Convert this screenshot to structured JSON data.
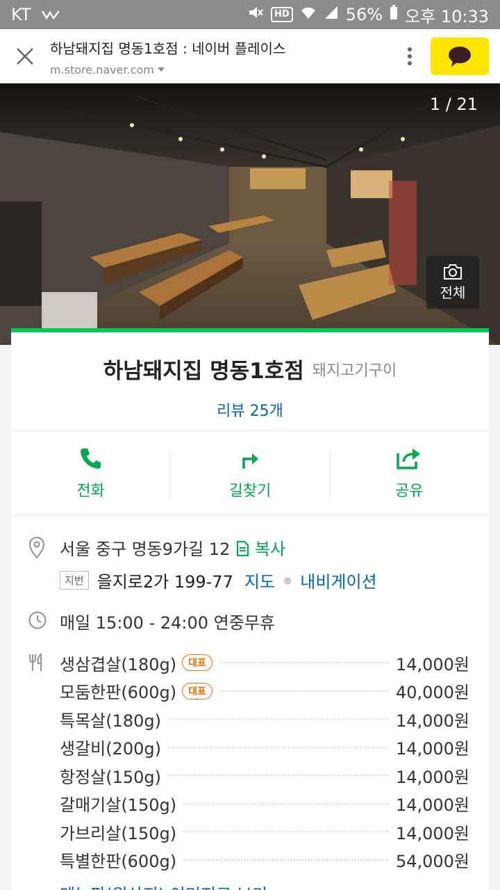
{
  "status_bar": {
    "carrier": "KT",
    "hd_label": "HD",
    "battery": "56%",
    "time": "오후 10:33"
  },
  "browser": {
    "title": "하남돼지집 명동1호점 : 네이버 플레이스",
    "url": "m.store.naver.com"
  },
  "hero": {
    "counter": "1 / 21",
    "view_all_label": "전체"
  },
  "place": {
    "name": "하남돼지집 명동1호점",
    "category": "돼지고기구이",
    "review_link": "리뷰 25개"
  },
  "actions": [
    {
      "label": "전화",
      "icon": "phone-icon"
    },
    {
      "label": "길찾기",
      "icon": "directions-icon"
    },
    {
      "label": "공유",
      "icon": "share-icon"
    }
  ],
  "address": {
    "road": "서울 중구 명동9가길 12",
    "copy_label": "복사",
    "jibun_badge": "지번",
    "jibun": "을지로2가 199-77",
    "map_link": "지도",
    "nav_link": "내비게이션"
  },
  "hours": "매일 15:00 - 24:00 연중무휴",
  "menu": {
    "items": [
      {
        "name": "생삼겹살(180g)",
        "badge": "대표",
        "price": "14,000원"
      },
      {
        "name": "모둠한판(600g)",
        "badge": "대표",
        "price": "40,000원"
      },
      {
        "name": "특목살(180g)",
        "badge": "",
        "price": "14,000원"
      },
      {
        "name": "생갈비(200g)",
        "badge": "",
        "price": "14,000원"
      },
      {
        "name": "항정살(150g)",
        "badge": "",
        "price": "14,000원"
      },
      {
        "name": "갈매기살(150g)",
        "badge": "",
        "price": "14,000원"
      },
      {
        "name": "가브리살(150g)",
        "badge": "",
        "price": "14,000원"
      },
      {
        "name": "특별한판(600g)",
        "badge": "",
        "price": "54,000원"
      }
    ],
    "more_link": "메뉴판(원산지) 이미지로 보기"
  },
  "colors": {
    "accent_green": "#03c75a",
    "link_blue": "#0064c8",
    "badge_orange": "#ff6a00",
    "kakao_yellow": "#ffe500"
  }
}
